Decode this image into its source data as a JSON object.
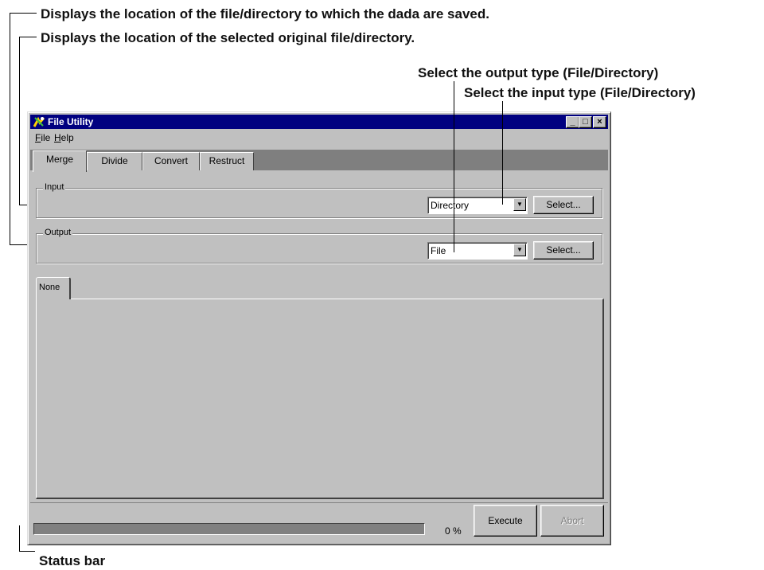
{
  "annotations": {
    "output_location": "Displays the location of the file/directory to which the dada are saved.",
    "input_location": "Displays the location of the selected original file/directory.",
    "output_type": "Select the output type (File/Directory)",
    "input_type": "Select the input type (File/Directory)",
    "status_bar": "Status bar"
  },
  "window": {
    "title": "File Utility",
    "title_color": "#000080",
    "icon": "file-utility-app-icon",
    "controls": {
      "minimize": "_",
      "maximize": "□",
      "close": "×"
    }
  },
  "menu": {
    "file": {
      "mnemonic": "F",
      "rest": "ile"
    },
    "help": {
      "mnemonic": "H",
      "rest": "elp"
    }
  },
  "tabs": [
    "Merge",
    "Divide",
    "Convert",
    "Restruct"
  ],
  "active_tab": "Merge",
  "input": {
    "label": "Input",
    "type": "Directory",
    "select_label": "Select..."
  },
  "output": {
    "label": "Output",
    "type": "File",
    "select_label": "Select..."
  },
  "inner_tab": "None",
  "status": {
    "progress_percent": 0,
    "progress_text": "0 %",
    "execute_label": "Execute",
    "abort_label": "Abort",
    "abort_enabled": false
  }
}
